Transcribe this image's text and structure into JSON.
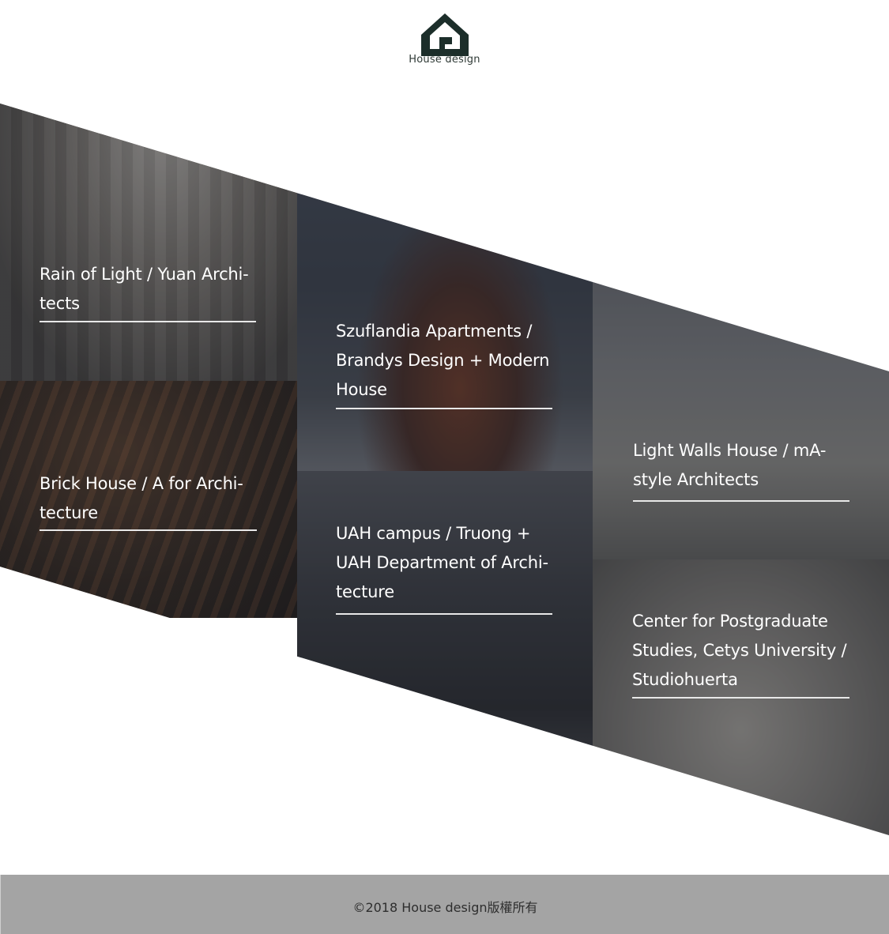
{
  "brand": {
    "logo_text": "House design",
    "logo_color": "#1c2e2a"
  },
  "gallery": {
    "items": [
      {
        "title_lines": [
          "Rain of Light / Yuan Archi-",
          "tects"
        ]
      },
      {
        "title_lines": [
          "Brick House / A for Archi-",
          "tecture"
        ]
      },
      {
        "title_lines": [
          "Szuflandia Apartments /",
          "Brandys Design + Modern",
          "House"
        ]
      },
      {
        "title_lines": [
          "UAH campus / Truong +",
          "UAH Department of Archi-",
          "tecture"
        ]
      },
      {
        "title_lines": [
          "Light Walls House / mA-",
          "style Architects"
        ]
      },
      {
        "title_lines": [
          "Center for Postgraduate",
          "Studies, Cetys University /",
          "Studiohuerta"
        ]
      }
    ]
  },
  "footer": {
    "copyright": "©2018  House design版權所有",
    "background": "#a4a4a4"
  }
}
